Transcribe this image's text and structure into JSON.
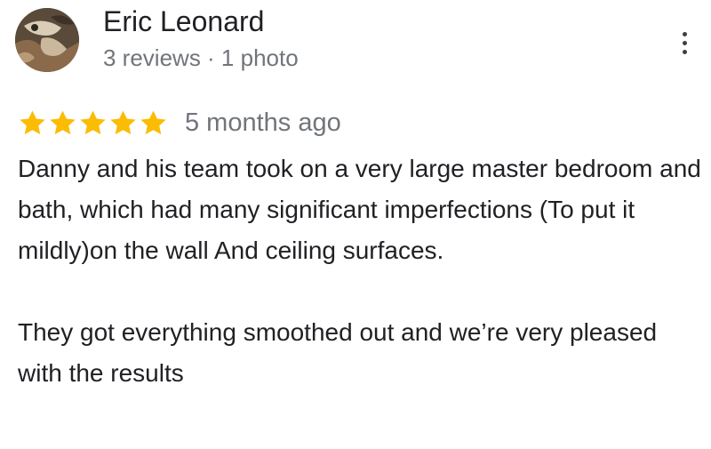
{
  "reviewer": {
    "name": "Eric Leonard",
    "meta": "3 reviews · 1 photo",
    "avatar_icon": "profile-photo"
  },
  "menu": {
    "icon": "more-vert-icon"
  },
  "rating": {
    "stars": 5,
    "max_stars": 5,
    "star_color": "#fbbc04",
    "date": "5 months ago"
  },
  "review": {
    "paragraph_1": "Danny and his team took on a very large master bedroom and bath, which had many significant imperfections (To put it mildly)on the wall And ceiling surfaces.",
    "paragraph_2": "They got everything smoothed out and we’re very pleased with the results"
  }
}
